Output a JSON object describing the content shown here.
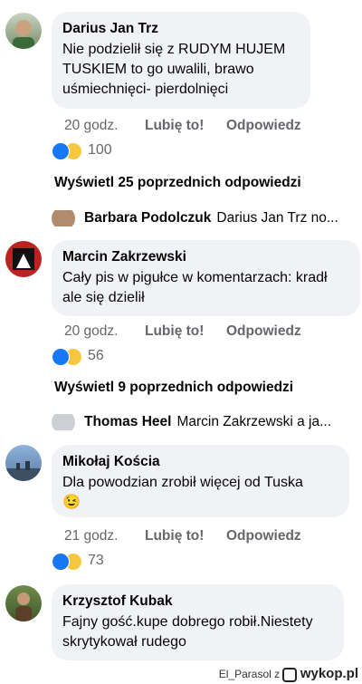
{
  "comments": [
    {
      "author": "Darius Jan Trz",
      "text": "Nie podzielił się z RUDYM HUJEM\nTUSKIEM  to go uwalili, brawo\nuśmiechnięci- pierdolnięci",
      "time": "20 godz.",
      "like": "Lubię to!",
      "reply": "Odpowiedz",
      "reactions": "100"
    },
    {
      "author": "Marcin Zakrzewski",
      "text": "Cały pis w pigułce w komentarzach: kradł\nale się dzielił",
      "time": "20 godz.",
      "like": "Lubię to!",
      "reply": "Odpowiedz",
      "reactions": "56"
    },
    {
      "author": "Mikołaj Kościa",
      "text": "Dla powodzian zrobił więcej od Tuska\n😉",
      "time": "21 godz.",
      "like": "Lubię to!",
      "reply": "Odpowiedz",
      "reactions": "73"
    },
    {
      "author": "Krzysztof Kubak",
      "text": "Fajny gość.kupe dobrego robił.Niestety\nskrytykował rudego"
    }
  ],
  "more_replies": [
    "Wyświetl 25 poprzednich odpowiedzi",
    "Wyświetl 9 poprzednich odpowiedzi"
  ],
  "previews": [
    {
      "author": "Barbara Podolczuk",
      "text": "Darius Jan Trz no..."
    },
    {
      "author": "Thomas Heel",
      "text": "Marcin Zakrzewski a ja..."
    }
  ],
  "footer": {
    "user": "El_Parasol",
    "sep": "z",
    "brand": "wykop.pl"
  },
  "colors": {
    "bubble": "#f0f2f5",
    "secondary": "#65676b",
    "like": "#1877f2",
    "haha": "#f7c83f"
  },
  "icons": [
    "avatar",
    "like-reaction-icon",
    "haha-reaction-icon",
    "wykop-logo-icon"
  ]
}
